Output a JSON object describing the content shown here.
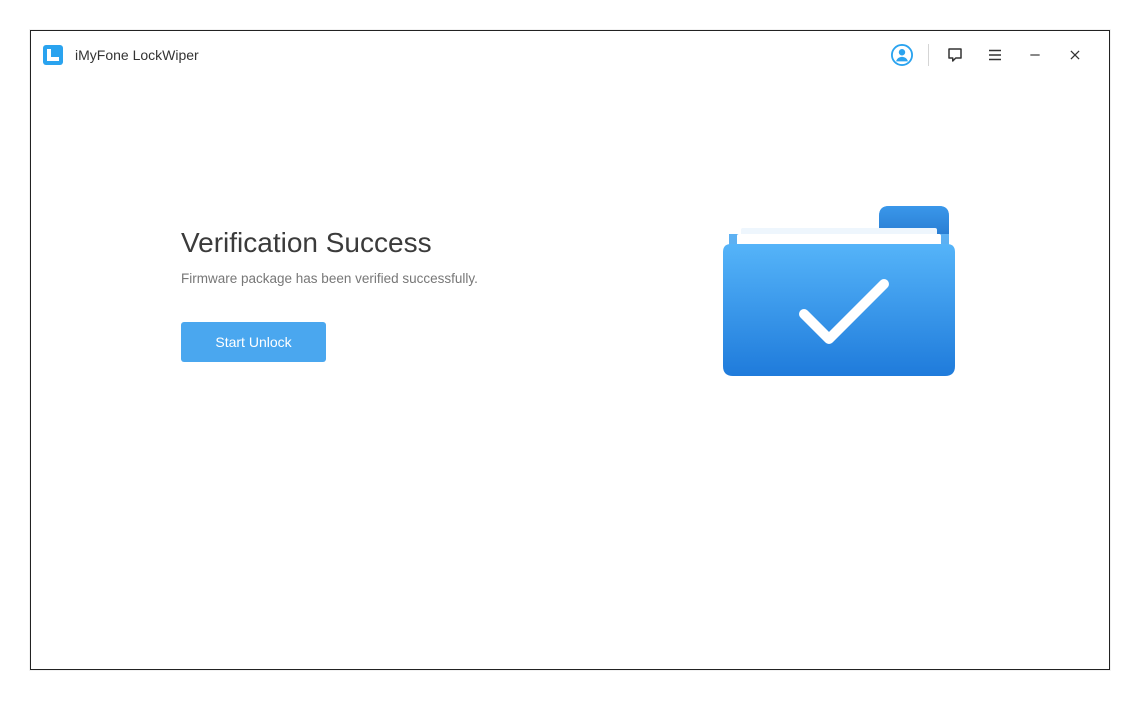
{
  "app": {
    "title": "iMyFone LockWiper"
  },
  "main": {
    "heading": "Verification Success",
    "subtext": "Firmware package has been verified successfully.",
    "primary_button": "Start Unlock"
  }
}
